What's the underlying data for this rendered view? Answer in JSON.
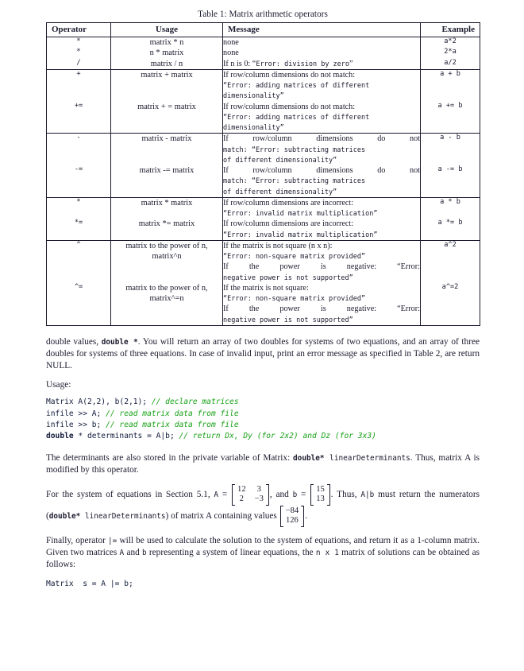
{
  "table": {
    "caption": "Table 1: Matrix arithmetic operators",
    "headers": {
      "operator": "Operator",
      "usage": "Usage",
      "message": "Message",
      "example": "Example"
    },
    "rows": [
      {
        "group": 1,
        "operator": "*",
        "usage": "matrix * n",
        "message_lines": [
          {
            "text": "none",
            "mono": false,
            "justify": false
          }
        ],
        "example": "a*2"
      },
      {
        "group": 1,
        "operator": "*",
        "usage": "n * matrix",
        "message_lines": [
          {
            "text": "none",
            "mono": false,
            "justify": false
          }
        ],
        "example": "2*a"
      },
      {
        "group": 1,
        "operator": "/",
        "usage": "matrix / n",
        "message_lines": [
          {
            "text": "If n is 0: “Error: division by zero”",
            "mono": false,
            "justify": false,
            "mixed": "If n is 0: |Error: division by zero|"
          }
        ],
        "example": "a/2"
      },
      {
        "group": 2,
        "operator": "+",
        "usage": "matrix + matrix",
        "message_lines": [
          {
            "text": "If row/column dimensions do not match:",
            "mono": false,
            "justify": false
          },
          {
            "text": "“Error: adding matrices of different",
            "mono": true,
            "justify": false
          },
          {
            "text": "dimensionality”",
            "mono": true,
            "justify": false
          }
        ],
        "example": "a + b"
      },
      {
        "group": 2,
        "operator": "+=",
        "usage": "matrix + = matrix",
        "message_lines": [
          {
            "text": "If row/column dimensions do not match:",
            "mono": false,
            "justify": false
          },
          {
            "text": "“Error: adding matrices of different",
            "mono": true,
            "justify": false
          },
          {
            "text": "dimensionality”",
            "mono": true,
            "justify": false
          }
        ],
        "example": "a += b"
      },
      {
        "group": 3,
        "operator": "-",
        "usage": "matrix - matrix",
        "message_lines": [
          {
            "text": "If row/column dimensions do not",
            "mono": false,
            "justify": true
          },
          {
            "text": "match: “Error: subtracting matrices",
            "mono": true,
            "justify": false
          },
          {
            "text": "of different dimensionality”",
            "mono": true,
            "justify": false
          }
        ],
        "example": "a - b"
      },
      {
        "group": 3,
        "operator": "-=",
        "usage": "matrix -= matrix",
        "message_lines": [
          {
            "text": "If row/column dimensions do not",
            "mono": false,
            "justify": true
          },
          {
            "text": "match: “Error: subtracting matrices",
            "mono": true,
            "justify": false
          },
          {
            "text": "of different dimensionality”",
            "mono": true,
            "justify": false
          }
        ],
        "example": "a -= b"
      },
      {
        "group": 4,
        "operator": "*",
        "usage": "matrix * matrix",
        "message_lines": [
          {
            "text": "If row/column dimensions are incorrect:",
            "mono": false,
            "justify": false
          },
          {
            "text": "“Error: invalid matrix multiplication”",
            "mono": true,
            "justify": false
          }
        ],
        "example": "a * b"
      },
      {
        "group": 4,
        "operator": "*=",
        "usage": "matrix *= matrix",
        "message_lines": [
          {
            "text": "If row/column dimensions are incorrect:",
            "mono": false,
            "justify": false
          },
          {
            "text": "“Error: invalid matrix multiplication”",
            "mono": true,
            "justify": false
          }
        ],
        "example": "a *= b"
      },
      {
        "group": 5,
        "operator": "^",
        "usage": "matrix to the power of n, matrix^n",
        "usage_lines": [
          "matrix to the power of n,",
          "matrix^n"
        ],
        "message_lines": [
          {
            "text": "If the matrix is not square (n x n):",
            "mono": false,
            "justify": false
          },
          {
            "text": "“Error: non-square matrix provided”",
            "mono": true,
            "justify": false
          },
          {
            "text": "If the power is negative: “Error:",
            "mono": false,
            "justify": true
          },
          {
            "text": "negative power is not supported”",
            "mono": true,
            "justify": false
          }
        ],
        "example": "a^2"
      },
      {
        "group": 5,
        "operator": "^=",
        "usage": "matrix to the power of n, matrix^=n",
        "usage_lines": [
          "matrix to the power of n,",
          "matrix^=n"
        ],
        "message_lines": [
          {
            "text": "If the matrix is not square:",
            "mono": false,
            "justify": false
          },
          {
            "text": "“Error: non-square matrix provided”",
            "mono": true,
            "justify": false
          },
          {
            "text": "If the power is negative: “Error:",
            "mono": false,
            "justify": true
          },
          {
            "text": "negative power is not supported”",
            "mono": true,
            "justify": false
          }
        ],
        "example": "a^=2"
      }
    ]
  },
  "body": {
    "para1_a": "double values, ",
    "para1_code": "double *",
    "para1_b": ". You will return an array of two doubles for systems of two equations, and an array of three doubles for systems of three equations. In case of invalid input, print an error message as specified in Table 2, are return NULL.",
    "usage_label": "Usage:",
    "code_lines": [
      {
        "code": "Matrix A(2,2), b(2,1); ",
        "comment": "// declare matrices",
        "bold_prefix": ""
      },
      {
        "code": "infile >> A; ",
        "comment": "// read matrix data from file",
        "bold_prefix": ""
      },
      {
        "code": "infile >> b; ",
        "comment": "// read matrix data from file",
        "bold_prefix": ""
      },
      {
        "code": " * determinants = A|b; ",
        "comment": "// return Dx, Dy (for 2x2) and Dz (for 3x3)",
        "bold_prefix": "double"
      }
    ],
    "para2_a": "The determinants are also stored in the private variable of Matrix: ",
    "para2_code1": "double*",
    "para2_code2": " linearDeterminants",
    "para2_b": ". Thus, matrix A is modified by this operator.",
    "para3_a": "For the system of equations in Section 5.1, ",
    "para3_A": "A",
    "para3_eq1": " = ",
    "para3_b_label": "b",
    "para3_mid": ", and ",
    "para3_eq2": " = ",
    "para3_tail_a": ". Thus, ",
    "para3_code_ab": "A|b",
    "para3_tail_b": " must return the numerators (",
    "para3_code_dbl": "double*",
    "para3_code_ld": " linearDeterminants",
    "para3_tail_c": ") of matrix A containing values ",
    "para3_period": ".",
    "matrix_A": {
      "rows": [
        [
          "12",
          "3"
        ],
        [
          "2",
          "−3"
        ]
      ]
    },
    "matrix_b": {
      "rows": [
        [
          "15"
        ],
        [
          "13"
        ]
      ]
    },
    "matrix_dets": {
      "rows": [
        [
          "−84"
        ],
        [
          "126"
        ]
      ]
    },
    "para4_a": "Finally, operator ",
    "para4_code1": "|=",
    "para4_b": " will be used to calculate the solution to the system of equations, and return it as a 1-column matrix. Given two matrices ",
    "para4_code2": "A",
    "para4_c": " and ",
    "para4_code3": "b",
    "para4_d": " representing a system of linear equations, the ",
    "para4_code4": "n x 1",
    "para4_e": " matrix of solutions can be obtained as follows:",
    "final_code": "Matrix  s = A |= b;"
  },
  "colors": {
    "text": "#1a1a2e",
    "comment_green": "#16a016",
    "rule": "#1a1a2e"
  }
}
